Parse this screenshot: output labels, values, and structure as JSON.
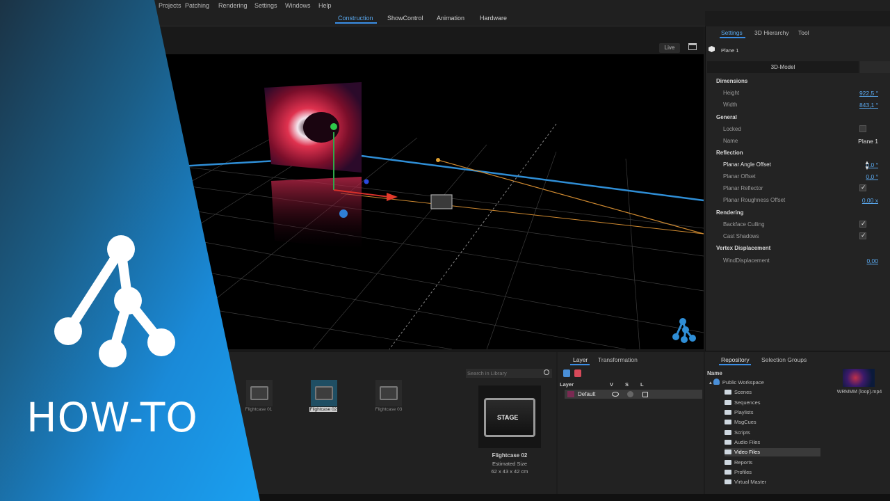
{
  "menu": [
    "Projects",
    "Patching",
    "Rendering",
    "Settings",
    "Windows",
    "Help"
  ],
  "modes": [
    "Construction",
    "ShowControl",
    "Animation",
    "Hardware"
  ],
  "viewport": {
    "live_label": "Live"
  },
  "right_panel": {
    "tabs": [
      "Settings",
      "3D Hierarchy",
      "Tool"
    ],
    "object_name": "Plane 1",
    "model_button": "3D-Model",
    "sections": {
      "dimensions": "Dimensions",
      "general": "General",
      "reflection": "Reflection",
      "rendering": "Rendering",
      "vertex": "Vertex Displacement"
    },
    "props": {
      "height_label": "Height",
      "height_value": "922,5 °",
      "width_label": "Width",
      "width_value": "843,1 °",
      "locked_label": "Locked",
      "name_label": "Name",
      "name_value": "Plane 1",
      "planar_angle_label": "Planar Angle Offset",
      "planar_angle_value": "0.0 °",
      "planar_offset_label": "Planar Offset",
      "planar_offset_value": "0,0 °",
      "planar_reflector_label": "Planar Reflector",
      "planar_roughness_label": "Planar Roughness Offset",
      "planar_roughness_value": "0,00 x",
      "backface_label": "Backface Culling",
      "cast_shadows_label": "Cast Shadows",
      "wind_label": "WindDisplacement",
      "wind_value": "0,00"
    }
  },
  "library": {
    "search_placeholder": "Search in Library",
    "items": [
      "Flightcase 01",
      "Flightcase 02",
      "Flightcase 03"
    ],
    "preview": {
      "name": "Flightcase 02",
      "size_label": "Estimated Size",
      "size": "62 x 43 x 42 cm",
      "case_text": "STAGE"
    }
  },
  "layer_panel": {
    "tabs": [
      "Layer",
      "Transformation"
    ],
    "headers": [
      "Layer",
      "V",
      "S",
      "L"
    ],
    "layers": [
      {
        "name": "Default",
        "color": "#7a2a52"
      }
    ]
  },
  "repository": {
    "tabs": [
      "Repository",
      "Selection Groups"
    ],
    "name_header": "Name",
    "root": "Public Workspace",
    "folders": [
      "Scenes",
      "Sequences",
      "Playlists",
      "MsgCues",
      "Scripts",
      "Audio Files",
      "Video Files",
      "Reports",
      "Profiles",
      "Virtual Master"
    ],
    "selected_folder": "Video Files",
    "file": "WRMMM (loop).mp4"
  },
  "overlay": {
    "title": "HOW-TO"
  },
  "colors": {
    "accent": "#3a8ee6",
    "link": "#5aa9ef",
    "banner": "#1a7ccc"
  }
}
